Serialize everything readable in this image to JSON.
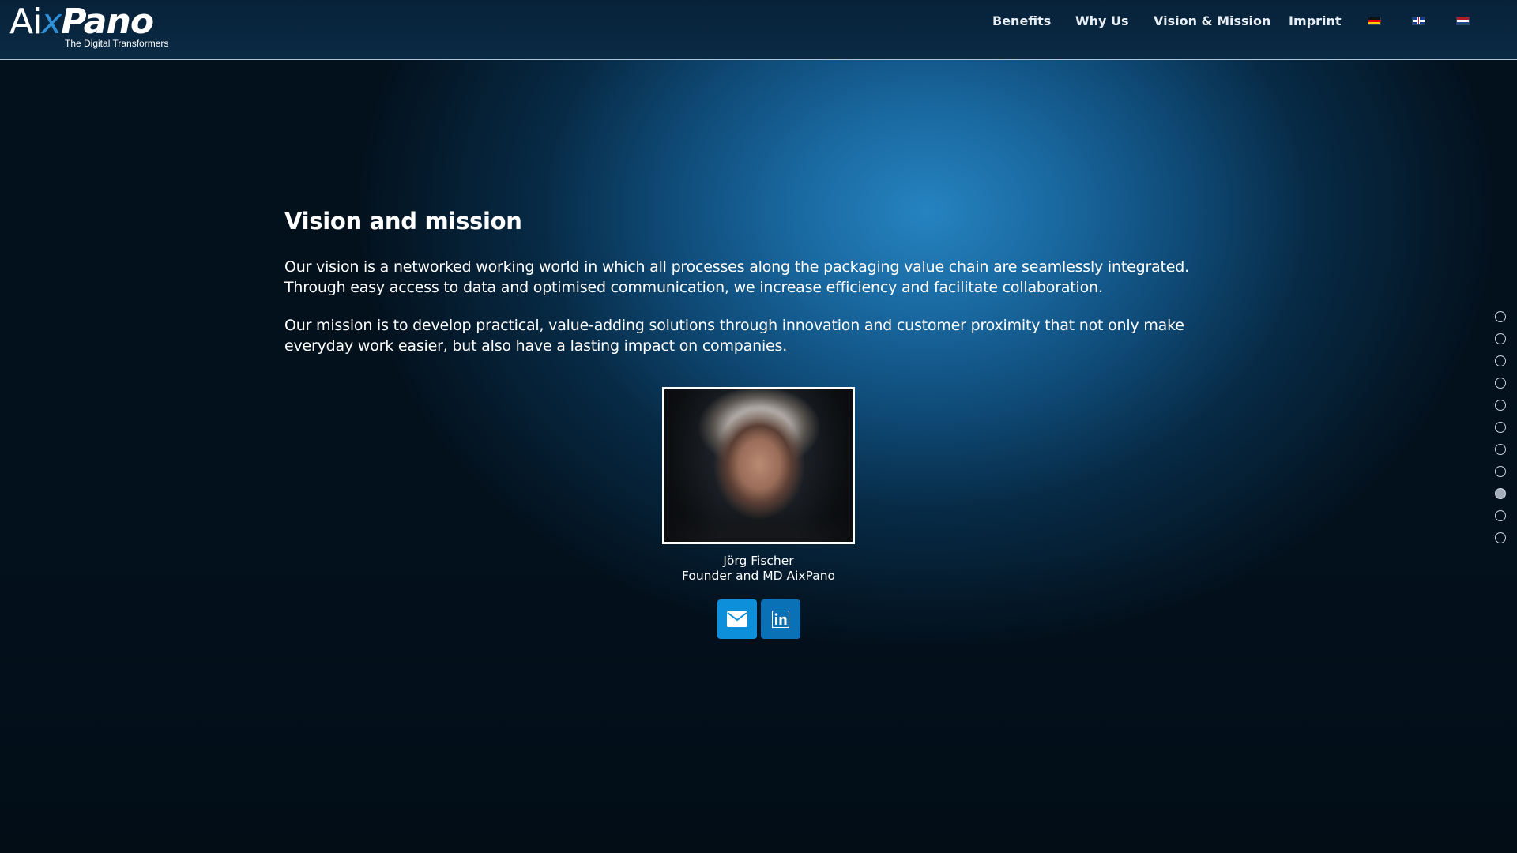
{
  "header": {
    "logo": {
      "part_aix": "Ai",
      "part_x": "x",
      "part_pano": "Pano",
      "tagline": "The Digital Transformers"
    },
    "nav": [
      {
        "label": "Benefits"
      },
      {
        "label": "Why Us"
      },
      {
        "label": "Vision & Mission"
      },
      {
        "label": "Imprint"
      }
    ],
    "languages": [
      {
        "icon": "flag-germany-icon"
      },
      {
        "icon": "flag-uk-icon"
      },
      {
        "icon": "flag-netherlands-icon"
      }
    ]
  },
  "main": {
    "title": "Vision and mission",
    "vision": "Our vision is a networked working world in which all processes along the packaging value chain are seamlessly integrated. Through easy access to data and optimised communication, we increase efficiency and facilitate collaboration.",
    "mission": "Our mission is to develop practical, value-adding solutions through innovation and customer proximity that not only make everyday work easier, but also have a lasting impact on companies."
  },
  "profile": {
    "name": "Jörg Fischer",
    "role": "Founder and MD AixPano",
    "buttons": [
      {
        "icon": "envelope-icon",
        "color": "#0e8fd9"
      },
      {
        "icon": "linkedin-icon",
        "color": "#0b71b7"
      }
    ]
  },
  "section_dots": {
    "count": 11,
    "active_index": 8
  },
  "colors": {
    "accent": "#2f8fd6",
    "background_dark": "#03111d",
    "glow": "#2683bf"
  }
}
